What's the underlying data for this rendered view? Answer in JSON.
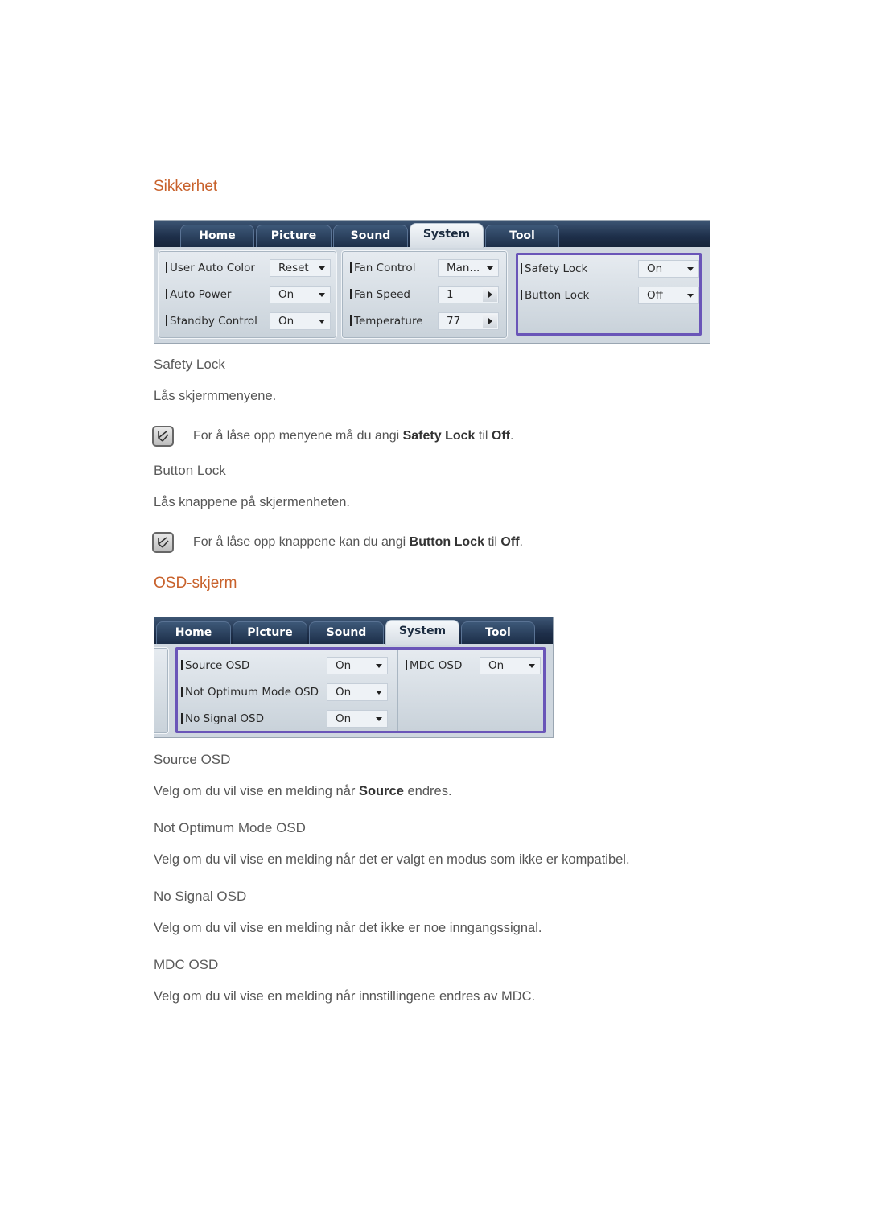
{
  "sections": {
    "security": {
      "title": "Sikkerhet",
      "panel": {
        "tabs": [
          "Home",
          "Picture",
          "Sound",
          "System",
          "Tool"
        ],
        "active_tab": "System",
        "group1": [
          {
            "label": "User Auto Color",
            "value": "Reset",
            "control": "dropdown"
          },
          {
            "label": "Auto Power",
            "value": "On",
            "control": "dropdown"
          },
          {
            "label": "Standby Control",
            "value": "On",
            "control": "dropdown"
          }
        ],
        "group2": [
          {
            "label": "Fan Control",
            "value": "Man...",
            "control": "dropdown"
          },
          {
            "label": "Fan Speed",
            "value": "1",
            "control": "spinner"
          },
          {
            "label": "Temperature",
            "value": "77",
            "control": "spinner"
          }
        ],
        "group3": [
          {
            "label": "Safety Lock",
            "value": "On",
            "control": "dropdown"
          },
          {
            "label": "Button Lock",
            "value": "Off",
            "control": "dropdown"
          }
        ]
      },
      "items": [
        {
          "heading": "Safety Lock",
          "description": "Lås skjermmenyene.",
          "note": {
            "pre": "For å låse opp menyene må du angi ",
            "b1": "Safety Lock",
            "mid": " til ",
            "b2": "Off",
            "post": "."
          }
        },
        {
          "heading": "Button Lock",
          "description": "Lås knappene på skjermenheten.",
          "note": {
            "pre": "For å låse opp knappene kan du angi ",
            "b1": "Button Lock",
            "mid": " til ",
            "b2": "Off",
            "post": "."
          }
        }
      ]
    },
    "osd": {
      "title": "OSD-skjerm",
      "panel": {
        "tabs": [
          "Home",
          "Picture",
          "Sound",
          "System",
          "Tool"
        ],
        "active_tab": "System",
        "group1": [
          {
            "label": "Source OSD",
            "value": "On",
            "control": "dropdown"
          },
          {
            "label": "Not Optimum Mode OSD",
            "value": "On",
            "control": "dropdown"
          },
          {
            "label": "No Signal OSD",
            "value": "On",
            "control": "dropdown"
          }
        ],
        "group2": [
          {
            "label": "MDC OSD",
            "value": "On",
            "control": "dropdown"
          }
        ]
      },
      "items": [
        {
          "heading": "Source OSD",
          "desc_pre": "Velg om du vil vise en melding når ",
          "desc_b": "Source",
          "desc_post": " endres."
        },
        {
          "heading": "Not Optimum Mode OSD",
          "description": "Velg om du vil vise en melding når det er valgt en modus som ikke er kompatibel."
        },
        {
          "heading": "No Signal OSD",
          "description": "Velg om du vil vise en melding når det ikke er noe inngangssignal."
        },
        {
          "heading": "MDC OSD",
          "description": "Velg om du vil vise en melding når innstillingene endres av MDC."
        }
      ]
    }
  },
  "icons": {
    "note": "note-pencil-icon"
  },
  "colors": {
    "section_title": "#c8612b",
    "highlight_border": "#6a55b8",
    "tabbar": "#1e2f4a"
  }
}
